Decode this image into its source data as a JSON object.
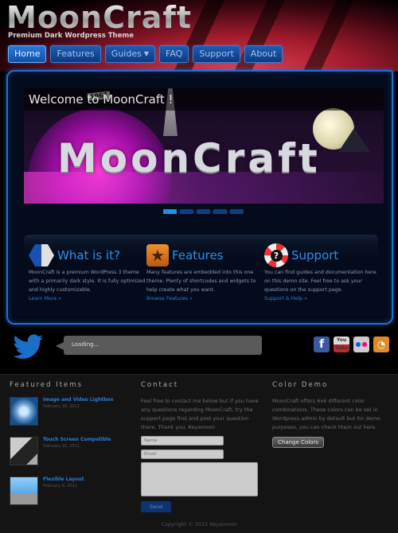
{
  "header": {
    "logo": "MoonCraft",
    "tagline": "Premium Dark Wordpress Theme",
    "nav": [
      {
        "label": "Home",
        "active": true
      },
      {
        "label": "Features"
      },
      {
        "label": "Guides",
        "has_dropdown": true
      },
      {
        "label": "FAQ"
      },
      {
        "label": "Support"
      },
      {
        "label": "About"
      }
    ],
    "accent_color": "#1d6fd6"
  },
  "slider": {
    "title": "Welcome to MoonCraft !",
    "image_text": "MoonCraft",
    "image_badge": "1967",
    "slide_count": 5,
    "active_slide": 1
  },
  "features": [
    {
      "icon": "hexagon-arrow-icon",
      "title": "What is it?",
      "text": "MoonCraft is a premium WordPress 3 theme with a primarily dark style. It is fully optimized and highly customizable.",
      "link": "Learn More »"
    },
    {
      "icon": "star-icon",
      "title": "Features",
      "text": "Many features are embedded into this one theme. Plenty of shortcodes and widgets to help create what you want.",
      "link": "Browse Features »"
    },
    {
      "icon": "lifebuoy-help-icon",
      "title": "Support",
      "text": "You can find guides and documentation here on this demo site. Feel free to ask your questions on the support page.",
      "link": "Support & Help »"
    }
  ],
  "twitter": {
    "status": "Loading..."
  },
  "social": [
    {
      "name": "facebook",
      "glyph": "f"
    },
    {
      "name": "youtube",
      "glyph": "You Tube"
    },
    {
      "name": "flickr",
      "glyph": ""
    },
    {
      "name": "rss",
      "glyph": "◔"
    }
  ],
  "footer": {
    "featured": {
      "heading": "Featured Items",
      "items": [
        {
          "title": "Image and Video Lightbox",
          "date": "February 18, 2011"
        },
        {
          "title": "Touch Screen Compatible",
          "date": "February 15, 2011"
        },
        {
          "title": "Flexible Layout",
          "date": "February 8, 2011"
        }
      ]
    },
    "contact": {
      "heading": "Contact",
      "text": "Feel free to contact me below but if you have any questions regarding MoonCraft, try the support page first and post your question there. Thank you, Keyamoon",
      "name_placeholder": "Name",
      "email_placeholder": "Email",
      "message_value": "",
      "send_label": "Send"
    },
    "color_demo": {
      "heading": "Color Demo",
      "text": "MoonCraft offers 6x6 different color combinations. These colors can be set in Wordpress admin by default but for demo purposes, you can check them out here.",
      "button_label": "Change Colors"
    },
    "copyright": "Copyright © 2011 Keyamoon"
  }
}
